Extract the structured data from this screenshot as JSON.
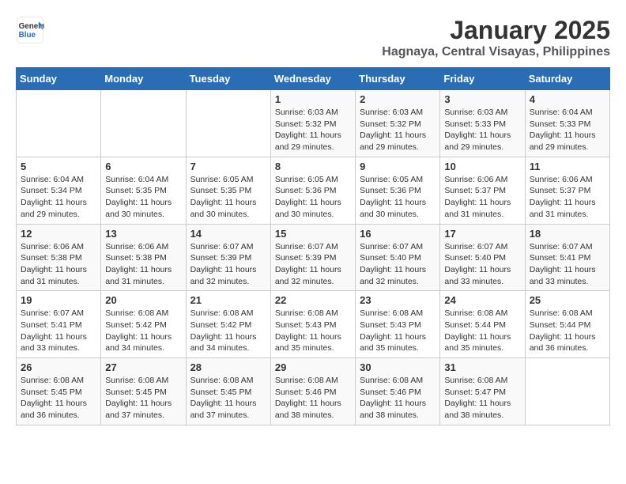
{
  "logo": {
    "line1": "General",
    "line2": "Blue"
  },
  "title": "January 2025",
  "subtitle": "Hagnaya, Central Visayas, Philippines",
  "weekdays": [
    "Sunday",
    "Monday",
    "Tuesday",
    "Wednesday",
    "Thursday",
    "Friday",
    "Saturday"
  ],
  "weeks": [
    [
      {
        "day": "",
        "sunrise": "",
        "sunset": "",
        "daylight": ""
      },
      {
        "day": "",
        "sunrise": "",
        "sunset": "",
        "daylight": ""
      },
      {
        "day": "",
        "sunrise": "",
        "sunset": "",
        "daylight": ""
      },
      {
        "day": "1",
        "sunrise": "Sunrise: 6:03 AM",
        "sunset": "Sunset: 5:32 PM",
        "daylight": "Daylight: 11 hours and 29 minutes."
      },
      {
        "day": "2",
        "sunrise": "Sunrise: 6:03 AM",
        "sunset": "Sunset: 5:32 PM",
        "daylight": "Daylight: 11 hours and 29 minutes."
      },
      {
        "day": "3",
        "sunrise": "Sunrise: 6:03 AM",
        "sunset": "Sunset: 5:33 PM",
        "daylight": "Daylight: 11 hours and 29 minutes."
      },
      {
        "day": "4",
        "sunrise": "Sunrise: 6:04 AM",
        "sunset": "Sunset: 5:33 PM",
        "daylight": "Daylight: 11 hours and 29 minutes."
      }
    ],
    [
      {
        "day": "5",
        "sunrise": "Sunrise: 6:04 AM",
        "sunset": "Sunset: 5:34 PM",
        "daylight": "Daylight: 11 hours and 29 minutes."
      },
      {
        "day": "6",
        "sunrise": "Sunrise: 6:04 AM",
        "sunset": "Sunset: 5:35 PM",
        "daylight": "Daylight: 11 hours and 30 minutes."
      },
      {
        "day": "7",
        "sunrise": "Sunrise: 6:05 AM",
        "sunset": "Sunset: 5:35 PM",
        "daylight": "Daylight: 11 hours and 30 minutes."
      },
      {
        "day": "8",
        "sunrise": "Sunrise: 6:05 AM",
        "sunset": "Sunset: 5:36 PM",
        "daylight": "Daylight: 11 hours and 30 minutes."
      },
      {
        "day": "9",
        "sunrise": "Sunrise: 6:05 AM",
        "sunset": "Sunset: 5:36 PM",
        "daylight": "Daylight: 11 hours and 30 minutes."
      },
      {
        "day": "10",
        "sunrise": "Sunrise: 6:06 AM",
        "sunset": "Sunset: 5:37 PM",
        "daylight": "Daylight: 11 hours and 31 minutes."
      },
      {
        "day": "11",
        "sunrise": "Sunrise: 6:06 AM",
        "sunset": "Sunset: 5:37 PM",
        "daylight": "Daylight: 11 hours and 31 minutes."
      }
    ],
    [
      {
        "day": "12",
        "sunrise": "Sunrise: 6:06 AM",
        "sunset": "Sunset: 5:38 PM",
        "daylight": "Daylight: 11 hours and 31 minutes."
      },
      {
        "day": "13",
        "sunrise": "Sunrise: 6:06 AM",
        "sunset": "Sunset: 5:38 PM",
        "daylight": "Daylight: 11 hours and 31 minutes."
      },
      {
        "day": "14",
        "sunrise": "Sunrise: 6:07 AM",
        "sunset": "Sunset: 5:39 PM",
        "daylight": "Daylight: 11 hours and 32 minutes."
      },
      {
        "day": "15",
        "sunrise": "Sunrise: 6:07 AM",
        "sunset": "Sunset: 5:39 PM",
        "daylight": "Daylight: 11 hours and 32 minutes."
      },
      {
        "day": "16",
        "sunrise": "Sunrise: 6:07 AM",
        "sunset": "Sunset: 5:40 PM",
        "daylight": "Daylight: 11 hours and 32 minutes."
      },
      {
        "day": "17",
        "sunrise": "Sunrise: 6:07 AM",
        "sunset": "Sunset: 5:40 PM",
        "daylight": "Daylight: 11 hours and 33 minutes."
      },
      {
        "day": "18",
        "sunrise": "Sunrise: 6:07 AM",
        "sunset": "Sunset: 5:41 PM",
        "daylight": "Daylight: 11 hours and 33 minutes."
      }
    ],
    [
      {
        "day": "19",
        "sunrise": "Sunrise: 6:07 AM",
        "sunset": "Sunset: 5:41 PM",
        "daylight": "Daylight: 11 hours and 33 minutes."
      },
      {
        "day": "20",
        "sunrise": "Sunrise: 6:08 AM",
        "sunset": "Sunset: 5:42 PM",
        "daylight": "Daylight: 11 hours and 34 minutes."
      },
      {
        "day": "21",
        "sunrise": "Sunrise: 6:08 AM",
        "sunset": "Sunset: 5:42 PM",
        "daylight": "Daylight: 11 hours and 34 minutes."
      },
      {
        "day": "22",
        "sunrise": "Sunrise: 6:08 AM",
        "sunset": "Sunset: 5:43 PM",
        "daylight": "Daylight: 11 hours and 35 minutes."
      },
      {
        "day": "23",
        "sunrise": "Sunrise: 6:08 AM",
        "sunset": "Sunset: 5:43 PM",
        "daylight": "Daylight: 11 hours and 35 minutes."
      },
      {
        "day": "24",
        "sunrise": "Sunrise: 6:08 AM",
        "sunset": "Sunset: 5:44 PM",
        "daylight": "Daylight: 11 hours and 35 minutes."
      },
      {
        "day": "25",
        "sunrise": "Sunrise: 6:08 AM",
        "sunset": "Sunset: 5:44 PM",
        "daylight": "Daylight: 11 hours and 36 minutes."
      }
    ],
    [
      {
        "day": "26",
        "sunrise": "Sunrise: 6:08 AM",
        "sunset": "Sunset: 5:45 PM",
        "daylight": "Daylight: 11 hours and 36 minutes."
      },
      {
        "day": "27",
        "sunrise": "Sunrise: 6:08 AM",
        "sunset": "Sunset: 5:45 PM",
        "daylight": "Daylight: 11 hours and 37 minutes."
      },
      {
        "day": "28",
        "sunrise": "Sunrise: 6:08 AM",
        "sunset": "Sunset: 5:45 PM",
        "daylight": "Daylight: 11 hours and 37 minutes."
      },
      {
        "day": "29",
        "sunrise": "Sunrise: 6:08 AM",
        "sunset": "Sunset: 5:46 PM",
        "daylight": "Daylight: 11 hours and 38 minutes."
      },
      {
        "day": "30",
        "sunrise": "Sunrise: 6:08 AM",
        "sunset": "Sunset: 5:46 PM",
        "daylight": "Daylight: 11 hours and 38 minutes."
      },
      {
        "day": "31",
        "sunrise": "Sunrise: 6:08 AM",
        "sunset": "Sunset: 5:47 PM",
        "daylight": "Daylight: 11 hours and 38 minutes."
      },
      {
        "day": "",
        "sunrise": "",
        "sunset": "",
        "daylight": ""
      }
    ]
  ]
}
